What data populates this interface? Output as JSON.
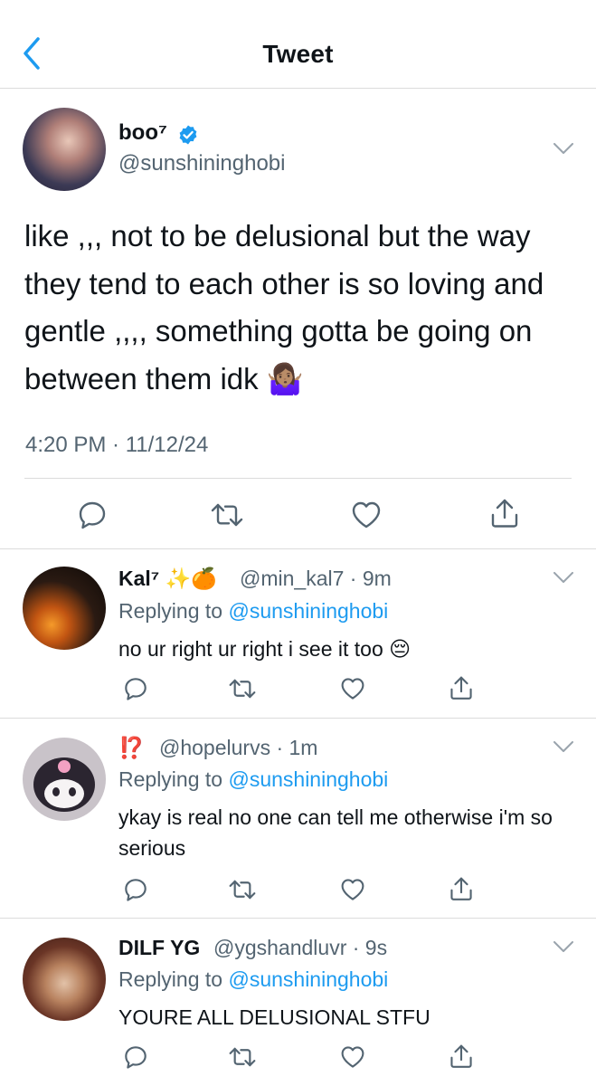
{
  "header": {
    "title": "Tweet",
    "back_icon": "chevron-left-icon"
  },
  "main_tweet": {
    "author_name": "boo⁷",
    "verified": true,
    "handle": "@sunshininghobi",
    "text": "like ,,, not to be delusional but the way they tend to each other is so loving and gentle ,,,, something gotta be going on between them idk 🤷🏽‍♀️",
    "timestamp": "4:20 PM · 11/12/24",
    "actions": [
      "reply-icon",
      "retweet-icon",
      "like-icon",
      "share-icon"
    ]
  },
  "replies": [
    {
      "author_name": "Kal⁷ ✨🍊",
      "handle_time": "@min_kal7 · 9m",
      "replying_prefix": "Replying to",
      "replying_handle": "@sunshininghobi",
      "text": "no ur right ur right i see it too 😔"
    },
    {
      "author_name": "⁉️",
      "handle_time": "@hopelurvs · 1m",
      "replying_prefix": "Replying to",
      "replying_handle": "@sunshininghobi",
      "text": "ykay is real no one can tell me otherwise i'm so serious"
    },
    {
      "author_name": "DILF YG",
      "handle_time": "@ygshandluvr · 9s",
      "replying_prefix": "Replying to",
      "replying_handle": "@sunshininghobi",
      "text": "YOURE ALL DELUSIONAL STFU"
    }
  ],
  "colors": {
    "link": "#1d9bf0",
    "secondary_text": "#536471",
    "divider": "#dcdcdc"
  }
}
